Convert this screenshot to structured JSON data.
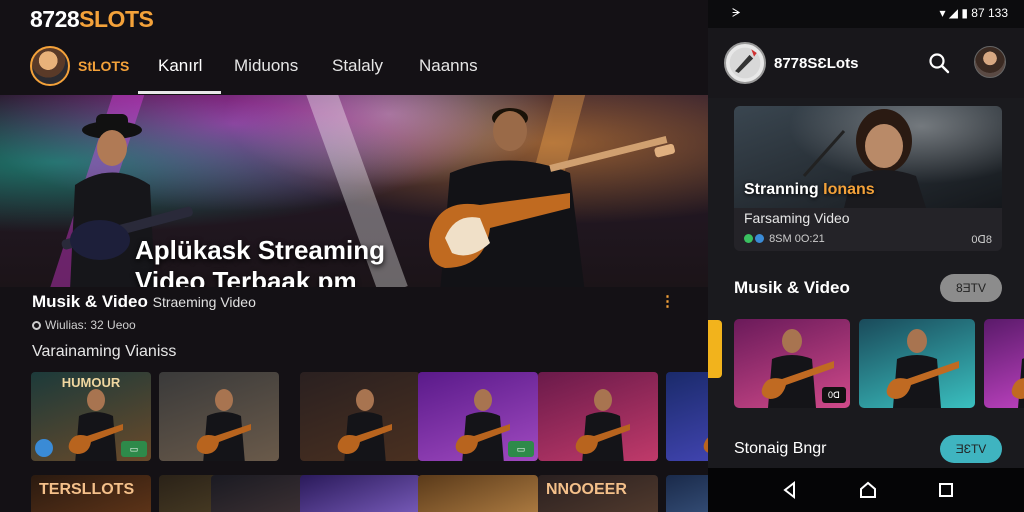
{
  "desktop": {
    "brand_prefix": "8728",
    "brand_suffix": "SLOTS",
    "nav": {
      "profile_label": "StLOTS",
      "tabs": [
        {
          "label": "Kanırl",
          "active": true
        },
        {
          "label": "Miduons",
          "active": false
        },
        {
          "label": "Stalaly",
          "active": false
        },
        {
          "label": "Naanns",
          "active": false
        }
      ]
    },
    "hero": {
      "title": "Aplükask Streaming Video Terbaak pm patur Musisi"
    },
    "info": {
      "title": "Musik & Video",
      "subtitle": "Straeming Video",
      "meta": "Wiulias: 32 Ueoo"
    },
    "section_title": "Varainaming Vianiss",
    "thumbnails": [
      {
        "label": "HUMOUR",
        "badge": "▭",
        "colors": [
          "#1c3a3a",
          "#6a4a2a"
        ],
        "circle": true
      },
      {
        "label": "",
        "badge": "",
        "colors": [
          "#3a3a3a",
          "#6a5a4a"
        ],
        "circle": false
      },
      {
        "label": "",
        "badge": "",
        "colors": [
          "#2a2020",
          "#4a3020"
        ],
        "circle": false
      },
      {
        "label": "",
        "badge": "▭",
        "colors": [
          "#5a1a8a",
          "#a04ac0"
        ],
        "circle": false
      },
      {
        "label": "",
        "badge": "",
        "colors": [
          "#6a1a4a",
          "#c03a6a"
        ],
        "circle": false
      },
      {
        "label": "",
        "badge": "",
        "colors": [
          "#1a2a6a",
          "#4a4ac0"
        ],
        "circle": false
      }
    ],
    "thumbnails_row2": [
      {
        "label": "TERSLLOTS",
        "colors": [
          "#2a1a10",
          "#6a3a1a"
        ]
      },
      {
        "label": "",
        "colors": [
          "#2a2218",
          "#5a4a2a"
        ]
      },
      {
        "label": "",
        "colors": [
          "#1a1a22",
          "#4a3a3a"
        ]
      },
      {
        "label": "",
        "colors": [
          "#2a1a5a",
          "#8a6ad0"
        ]
      },
      {
        "label": "",
        "colors": [
          "#5a3a1a",
          "#c08a4a"
        ]
      },
      {
        "label": "NNOOEER",
        "colors": [
          "#2a2020",
          "#5a4030"
        ]
      },
      {
        "label": "",
        "colors": [
          "#1a2a4a",
          "#4a6a9a"
        ]
      }
    ]
  },
  "phone": {
    "status": {
      "left": "ᗒ",
      "right": "▾ ◢ ▮ 87 133"
    },
    "app_name": "8778SƐLots",
    "featured": {
      "title_a": "Stranning",
      "title_b": "Ionans",
      "subtitle": "Farsaming Video",
      "stats": "8SM 0O:21",
      "duration": "0ᗡ8"
    },
    "section1": {
      "title": "Musik & Video",
      "button": "8ƎTV"
    },
    "section2": {
      "title": "Stonaig Bngr",
      "button": "ƎƐTV"
    },
    "rthumbs": [
      {
        "badge": "0ᗡ",
        "colors": [
          "#6a1a5a",
          "#d04a8a"
        ]
      },
      {
        "badge": "",
        "colors": [
          "#1a4a5a",
          "#3ac0c0"
        ]
      },
      {
        "badge": "",
        "colors": [
          "#5a1a6a",
          "#d04ad0"
        ]
      }
    ]
  },
  "colors": {
    "accent": "#f4a23a",
    "teal": "#3fb4c0",
    "button_gray": "#8c8c8c"
  }
}
